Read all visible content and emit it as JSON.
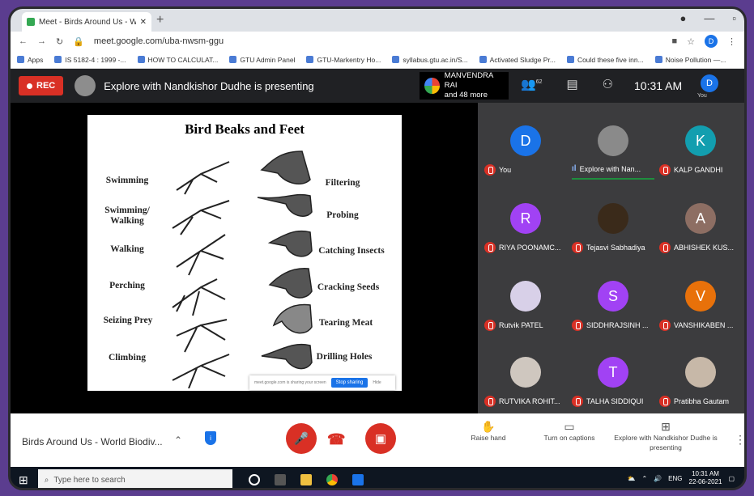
{
  "browser": {
    "tab_title": "Meet - Birds Around Us - W",
    "url": "meet.google.com/uba-nwsm-ggu",
    "account_initial": "D",
    "bookmarks": [
      "Apps",
      "IS 5182-4 : 1999 -...",
      "HOW TO CALCULAT...",
      "GTU Admin Panel",
      "GTU-Markentry Ho...",
      "syllabus.gtu.ac.in/S...",
      "Activated Sludge Pr...",
      "Could these five inn...",
      "Noise Pollution —..."
    ]
  },
  "meet_top": {
    "rec_label": "REC",
    "presenting_text": "Explore with Nandkishor Dudhe is presenting",
    "speaker_name": "MANVENDRA RAI",
    "speaker_more": "and 48 more",
    "participant_count": "62",
    "time": "10:31 AM",
    "self_initial": "D",
    "self_label": "You"
  },
  "slide": {
    "title": "Bird Beaks and Feet",
    "feet_labels": [
      "Swimming",
      "Swimming/ Walking",
      "Walking",
      "Perching",
      "Seizing Prey",
      "Climbing"
    ],
    "beak_labels": [
      "Filtering",
      "Probing",
      "Catching Insects",
      "Cracking Seeds",
      "Tearing Meat",
      "Drilling Holes"
    ],
    "share_notice": "meet.google.com is sharing your screen",
    "stop_sharing": "Stop sharing",
    "hide": "Hide"
  },
  "participants": [
    {
      "name": "You",
      "initial": "D",
      "color": "#1a73e8",
      "speaking": false
    },
    {
      "name": "Explore with Nan...",
      "initial": "",
      "color": "#8a8a8a",
      "speaking": true
    },
    {
      "name": "KALP GANDHI",
      "initial": "K",
      "color": "#129eaf",
      "speaking": false
    },
    {
      "name": "RIYA POONAMC...",
      "initial": "R",
      "color": "#a142f4",
      "speaking": false
    },
    {
      "name": "Tejasvi Sabhadiya",
      "initial": "",
      "color": "#3a2a1a",
      "speaking": false
    },
    {
      "name": "ABHISHEK KUS...",
      "initial": "A",
      "color": "#8d6e63",
      "speaking": false
    },
    {
      "name": "Rutvik PATEL",
      "initial": "",
      "color": "#d8d0e8",
      "speaking": false
    },
    {
      "name": "SIDDHRAJSINH ...",
      "initial": "S",
      "color": "#a142f4",
      "speaking": false
    },
    {
      "name": "VANSHIKABEN ...",
      "initial": "V",
      "color": "#e8710a",
      "speaking": false
    },
    {
      "name": "RUTVIKA ROHIT...",
      "initial": "",
      "color": "#cfc7bf",
      "speaking": false
    },
    {
      "name": "TALHA SIDDIQUI",
      "initial": "T",
      "color": "#a142f4",
      "speaking": false
    },
    {
      "name": "Pratibha Gautam",
      "initial": "",
      "color": "#c7b8a8",
      "speaking": false
    }
  ],
  "bottom": {
    "meeting_title": "Birds Around Us - World Biodiv...",
    "raise_hand": "Raise hand",
    "captions": "Turn on captions",
    "presenting": "Explore with Nandkishor Dudhe is presenting"
  },
  "taskbar": {
    "search_placeholder": "Type here to search",
    "lang": "ENG",
    "time": "10:31 AM",
    "date": "22-06-2021"
  }
}
